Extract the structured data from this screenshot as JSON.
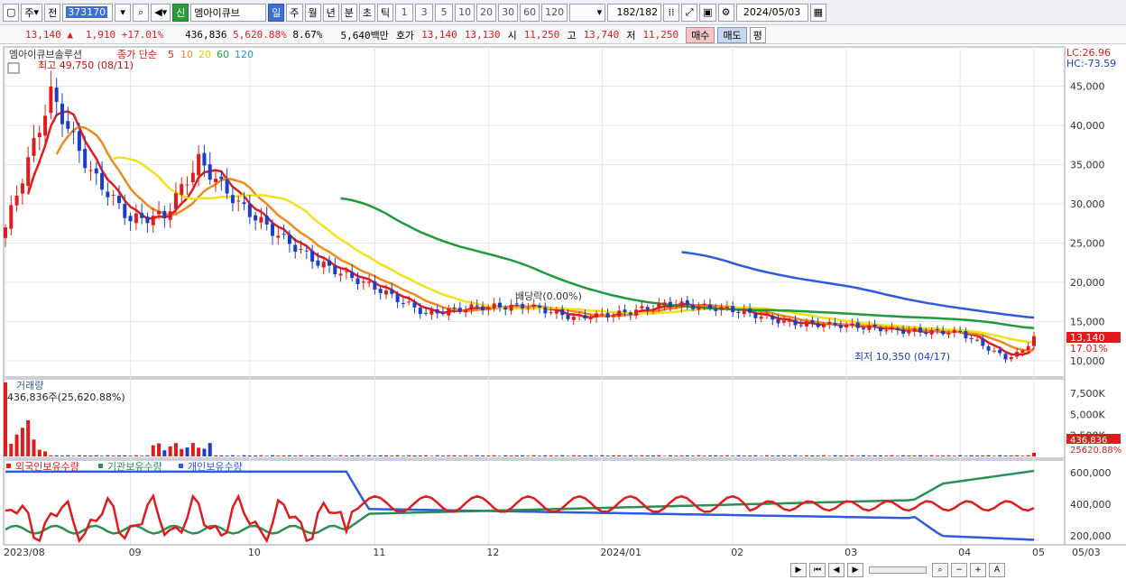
{
  "toolbar": {
    "prefix1": "주",
    "prefix2": "전",
    "code": "373170",
    "new_badge": "신",
    "name": "엠아이큐브",
    "periods": [
      "일",
      "주",
      "월",
      "년",
      "분",
      "초",
      "틱"
    ],
    "active_period": "일",
    "numbers": [
      "1",
      "3",
      "5",
      "10",
      "20",
      "30",
      "60",
      "120"
    ],
    "count": "182",
    "total": "/182",
    "date": "2024/05/03"
  },
  "info": {
    "price": "13,140",
    "arrow": "▲",
    "change": "1,910",
    "change_pct": "+17.01%",
    "volume": "436,836",
    "volume_pct": "5,620.88%",
    "turnover": "8.67%",
    "amount": "5,640백만",
    "hoga_label": "호가",
    "ask": "13,140",
    "bid": "13,130",
    "open_label": "시",
    "open": "11,250",
    "high_label": "고",
    "high": "13,740",
    "low_label": "저",
    "low": "11,250",
    "buy": "매수",
    "sell": "매도",
    "eval": "평"
  },
  "price_panel": {
    "title": "엠아이큐브솔루션",
    "legend_prefix": "종가 단순",
    "ma_labels": [
      "5",
      "10",
      "20",
      "60",
      "120"
    ],
    "high_annot": "최고 49,750 (08/11)",
    "low_annot": "최저 10,350 (04/17)",
    "dividend_annot": "배당락(0.00%)",
    "lc": "LC:26.96",
    "hc": "HC:-73.59",
    "y_ticks": [
      "45,000",
      "40,000",
      "35,000",
      "30,000",
      "25,000",
      "20,000",
      "15,000",
      "10,000"
    ],
    "current_price_label": "13,140",
    "current_pct_label": "17.01%"
  },
  "volume_panel": {
    "title": "거래량",
    "annot": "436,836주(25,620.88%)",
    "y_ticks": [
      "7,500K",
      "5,000K",
      "2,500K"
    ],
    "current_label": "436,836",
    "current_pct": "25620.88%"
  },
  "holdings_panel": {
    "legends": [
      "외국인보유수량",
      "기관보유수량",
      "개인보유수량"
    ],
    "y_ticks": [
      "600,000",
      "400,000",
      "200,000"
    ]
  },
  "x_axis": {
    "labels": [
      "2023/08",
      "09",
      "10",
      "11",
      "12",
      "2024/01",
      "02",
      "03",
      "04",
      "05",
      "05/03"
    ]
  },
  "colors": {
    "up": "#e01b1b",
    "down": "#1a3fc4",
    "ma5": "#e01b1b",
    "ma10": "#f08a1a",
    "ma20": "#f0e21a",
    "ma60": "#1f9a3a",
    "ma120": "#2b5be0",
    "foreign": "#e01b1b",
    "institution": "#2b8f55",
    "individual": "#2b5be0"
  },
  "chart_data": {
    "type": "candlestick",
    "x_range": [
      "2023/08",
      "2024/05/03"
    ],
    "price_ylim": [
      10000,
      50000
    ],
    "closes_sampled": [
      {
        "x": "2023/08",
        "close": 27000
      },
      {
        "x": "2023/08/11",
        "close": 44000
      },
      {
        "x": "2023/08/20",
        "close": 34000
      },
      {
        "x": "2023/08/31",
        "close": 28000
      },
      {
        "x": "2023/09/08",
        "close": 28500
      },
      {
        "x": "2023/09/15",
        "close": 35500
      },
      {
        "x": "2023/09/25",
        "close": 30000
      },
      {
        "x": "2023/10/05",
        "close": 26000
      },
      {
        "x": "2023/10/16",
        "close": 22500
      },
      {
        "x": "2023/10/31",
        "close": 19000
      },
      {
        "x": "2023/11/10",
        "close": 16000
      },
      {
        "x": "2023/11/22",
        "close": 16800
      },
      {
        "x": "2023/12/08",
        "close": 17000
      },
      {
        "x": "2023/12/20",
        "close": 15500
      },
      {
        "x": "2024/01/02",
        "close": 16000
      },
      {
        "x": "2024/01/15",
        "close": 17300
      },
      {
        "x": "2024/01/31",
        "close": 16500
      },
      {
        "x": "2024/02/15",
        "close": 14800
      },
      {
        "x": "2024/03/01",
        "close": 14500
      },
      {
        "x": "2024/03/15",
        "close": 13800
      },
      {
        "x": "2024/04/01",
        "close": 13600
      },
      {
        "x": "2024/04/17",
        "close": 10350
      },
      {
        "x": "2024/04/30",
        "close": 11200
      },
      {
        "x": "2024/05/03",
        "close": 13140
      }
    ],
    "volume_ylim": [
      0,
      9000
    ],
    "volume_unit": "K",
    "holdings_ylim": [
      150000,
      650000
    ]
  }
}
